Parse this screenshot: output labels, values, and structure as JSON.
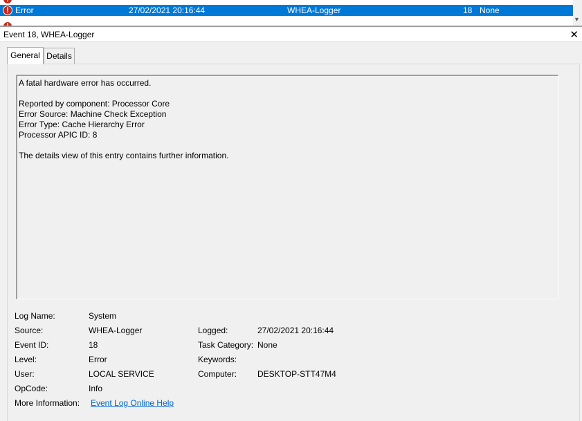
{
  "event_list": {
    "rows": [
      {
        "level": "Error",
        "datetime": "27/02/2021 20:16:44",
        "source": "WHEA-Logger",
        "event_id": "18",
        "task_category": "None",
        "selected": true
      }
    ]
  },
  "detail": {
    "title": "Event 18, WHEA-Logger",
    "close_glyph": "✕"
  },
  "tabs": {
    "general": "General",
    "details": "Details"
  },
  "description": {
    "lines": [
      "A fatal hardware error has occurred.",
      "",
      "Reported by component: Processor Core",
      "Error Source: Machine Check Exception",
      "Error Type: Cache Hierarchy Error",
      "Processor APIC ID: 8",
      "",
      "The details view of this entry contains further information."
    ]
  },
  "properties": {
    "log_name": {
      "label": "Log Name:",
      "value": "System"
    },
    "source": {
      "label": "Source:",
      "value": "WHEA-Logger"
    },
    "event_id": {
      "label": "Event ID:",
      "value": "18"
    },
    "level": {
      "label": "Level:",
      "value": "Error"
    },
    "user": {
      "label": "User:",
      "value": "LOCAL SERVICE"
    },
    "opcode": {
      "label": "OpCode:",
      "value": "Info"
    },
    "more_info": {
      "label": "More Information:",
      "value": "Event Log Online Help"
    },
    "logged": {
      "label": "Logged:",
      "value": "27/02/2021 20:16:44"
    },
    "task_category": {
      "label": "Task Category:",
      "value": "None"
    },
    "keywords": {
      "label": "Keywords:",
      "value": ""
    },
    "computer": {
      "label": "Computer:",
      "value": "DESKTOP-STT47M4"
    }
  },
  "colors": {
    "selection": "#0078d7",
    "error_icon": "#c42b1c",
    "link": "#0066cc"
  }
}
